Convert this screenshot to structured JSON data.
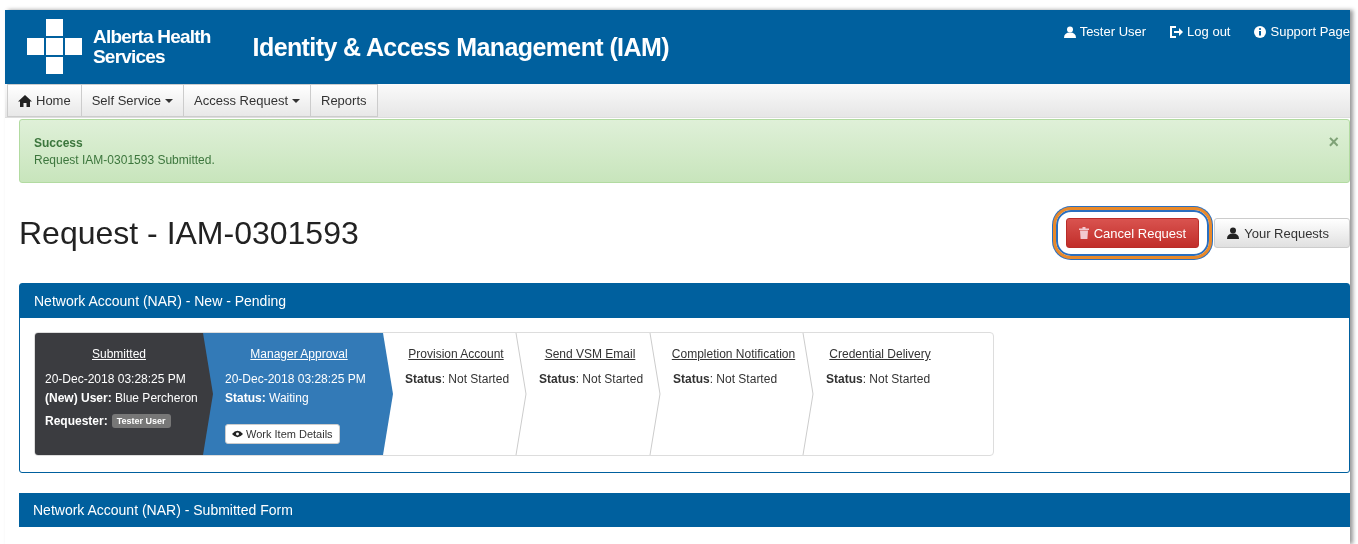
{
  "header": {
    "logo_lines": [
      "Alberta Health",
      "Services"
    ],
    "title": "Identity & Access Management (IAM)",
    "links": [
      {
        "kind": "user",
        "label": "Tester User"
      },
      {
        "kind": "logout",
        "label": "Log out"
      },
      {
        "kind": "info",
        "label": "Support Page"
      }
    ]
  },
  "nav": [
    {
      "label": "Home",
      "kind": "home"
    },
    {
      "label": "Self Service",
      "kind": "dropdown"
    },
    {
      "label": "Access Request",
      "kind": "dropdown"
    },
    {
      "label": "Reports",
      "kind": "plain"
    }
  ],
  "alert": {
    "title": "Success",
    "message": "Request IAM-0301593 Submitted.",
    "close": "×"
  },
  "page_title": "Request - IAM-0301593",
  "actions": [
    {
      "kind": "danger",
      "label": "Cancel Request",
      "highlighted": true
    },
    {
      "kind": "default",
      "label": "Your Requests",
      "highlighted": false
    }
  ],
  "panels": [
    {
      "title": "Network Account (NAR) - New - Pending",
      "steps": [
        {
          "kind": "done",
          "title": "Submitted",
          "lines": [
            "20-Dec-2018 03:28:25 PM",
            "**(New) User:** Blue Percheron"
          ],
          "requester": {
            "label": "Requester:",
            "badge": "Tester User"
          }
        },
        {
          "kind": "current",
          "title": "Manager Approval",
          "lines": [
            "20-Dec-2018 03:28:25 PM",
            "**Status:** Waiting"
          ],
          "button": "Work Item Details"
        },
        {
          "kind": "pending",
          "title": "Provision Account",
          "lines": [
            "**Status**: Not Started"
          ]
        },
        {
          "kind": "pending",
          "title": "Send VSM Email",
          "lines": [
            "**Status**: Not Started"
          ]
        },
        {
          "kind": "pending",
          "title": "Completion Notification",
          "lines": [
            "**Status**: Not Started"
          ]
        },
        {
          "kind": "pending",
          "title": "Credential Delivery",
          "lines": [
            "**Status**: Not Started"
          ]
        }
      ]
    },
    {
      "title": "Network Account (NAR) - Submitted Form"
    }
  ]
}
